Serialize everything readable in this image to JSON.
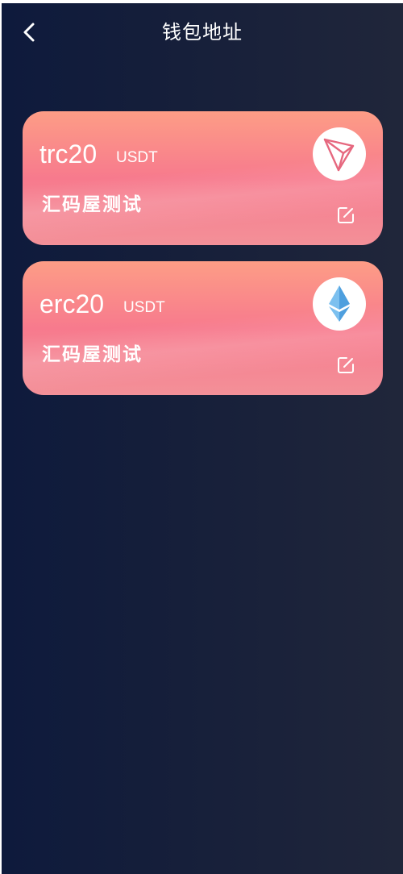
{
  "header": {
    "title": "钱包地址",
    "back_icon": "chevron-left-icon"
  },
  "wallets": [
    {
      "chain": "trc20",
      "symbol": "USDT",
      "name": "汇码屋测试",
      "logo_icon": "tron-logo-icon",
      "edit_icon": "edit-icon"
    },
    {
      "chain": "erc20",
      "symbol": "USDT",
      "name": "汇码屋测试",
      "logo_icon": "ethereum-logo-icon",
      "edit_icon": "edit-icon"
    }
  ],
  "colors": {
    "background_start": "#0e1a3c",
    "background_end": "#20263a",
    "card_top": "#fd9d86",
    "card_middle": "#f77a8d",
    "card_bottom": "#f39098",
    "tron_logo": "#e6687f",
    "ethereum_logo": "#4e9fde"
  }
}
